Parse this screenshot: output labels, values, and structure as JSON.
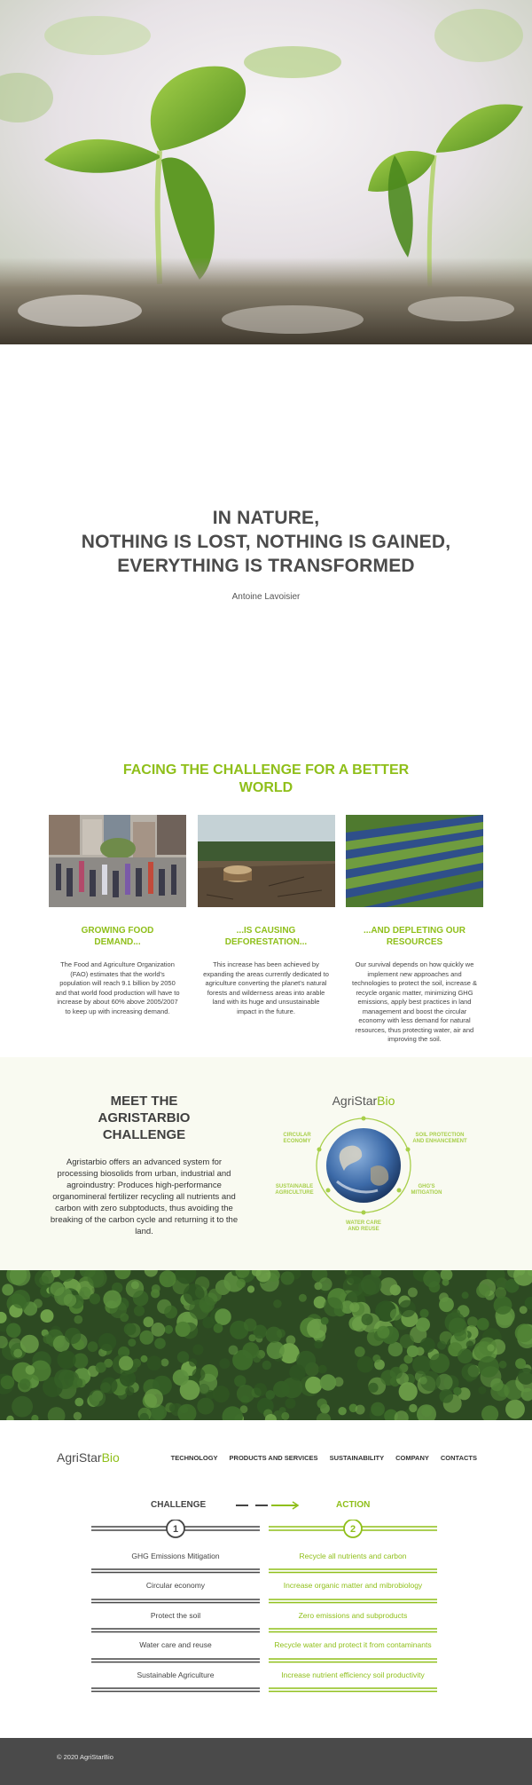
{
  "hero": {
    "alt": "sprouting seedlings"
  },
  "quote": {
    "line1": "IN NATURE,",
    "line2": "NOTHING IS LOST, NOTHING IS GAINED,",
    "line3": "EVERYTHING IS TRANSFORMED",
    "author": "Antoine Lavoisier"
  },
  "challenge": {
    "title_line1": "FACING THE CHALLENGE FOR A BETTER",
    "title_line2": "WORLD",
    "cards": [
      {
        "title_line1": "GROWING FOOD",
        "title_line2": "DEMAND...",
        "text": "The Food and Agriculture Organization (FAO) estimates that the world's population will reach 9.1 billion by 2050 and that world food production will have to increase by about 60% above 2005/2007 to keep up with increasing demand."
      },
      {
        "title_line1": "...IS CAUSING",
        "title_line2": "DEFORESTATION...",
        "text": "This increase has been achieved by expanding the areas currently dedicated to agriculture converting the planet's natural forests and wilderness areas into arable land with its huge and unsustainable impact in the future."
      },
      {
        "title_line1": "...AND DEPLETING OUR",
        "title_line2": "RESOURCES",
        "text": "Our survival depends on how quickly we implement new approaches and technologies to protect the soil, increase & recycle organic matter, minimizing GHG emissions, apply best practices in land management and boost the circular economy with less demand for natural resources, thus protecting water, air and improving the soil."
      }
    ]
  },
  "meet": {
    "title_line1": "MEET THE",
    "title_line2": "AGRISTARBIO",
    "title_line3": "CHALLENGE",
    "text": "Agristarbio offers an advanced system for processing biosolids from urban, industrial and agroindustry: Produces high-performance organomineral fertilizer recycling all nutrients and carbon with zero subptoducts, thus avoiding the breaking of the carbon cycle and returning it to the land.",
    "diagram": {
      "brand": "AgriStar",
      "brand_accent": "Bio",
      "labels": {
        "circular1": "CIRCULAR",
        "circular2": "ECONOMY",
        "soil1": "SOIL PROTECTION",
        "soil2": "AND ENHANCEMENT",
        "sust1": "SUSTAINABLE",
        "sust2": "AGRICULTURE",
        "ghg1": "GHG'S",
        "ghg2": "MITIGATION",
        "water1": "WATER CARE",
        "water2": "AND REUSE"
      }
    }
  },
  "nav": {
    "brand": "AgriStar",
    "brand_accent": "Bio",
    "items": [
      "TECHNOLOGY",
      "PRODUCTS AND SERVICES",
      "SUSTAINABILITY",
      "COMPANY",
      "CONTACTS"
    ]
  },
  "challenge_action": {
    "challenge_label": "CHALLENGE",
    "action_label": "ACTION",
    "step1": "1",
    "step2": "2",
    "rows": [
      {
        "challenge": "GHG Emissions Mitigation",
        "action": "Recycle all nutrients and carbon"
      },
      {
        "challenge": "Circular economy",
        "action": "Increase organic matter and mibrobiology"
      },
      {
        "challenge": "Protect the soil",
        "action": "Zero emissions and subproducts"
      },
      {
        "challenge": "Water care and reuse",
        "action": "Recycle water and protect it from contaminants"
      },
      {
        "challenge": "Sustainable Agriculture",
        "action": "Increase nutrient efficiency soil productivity"
      }
    ]
  },
  "footer": {
    "copyright": "© 2020 AgriStarBio"
  },
  "colors": {
    "accent": "#8fbf1a",
    "text": "#4a4a4a",
    "footer": "#4a4a4a"
  }
}
